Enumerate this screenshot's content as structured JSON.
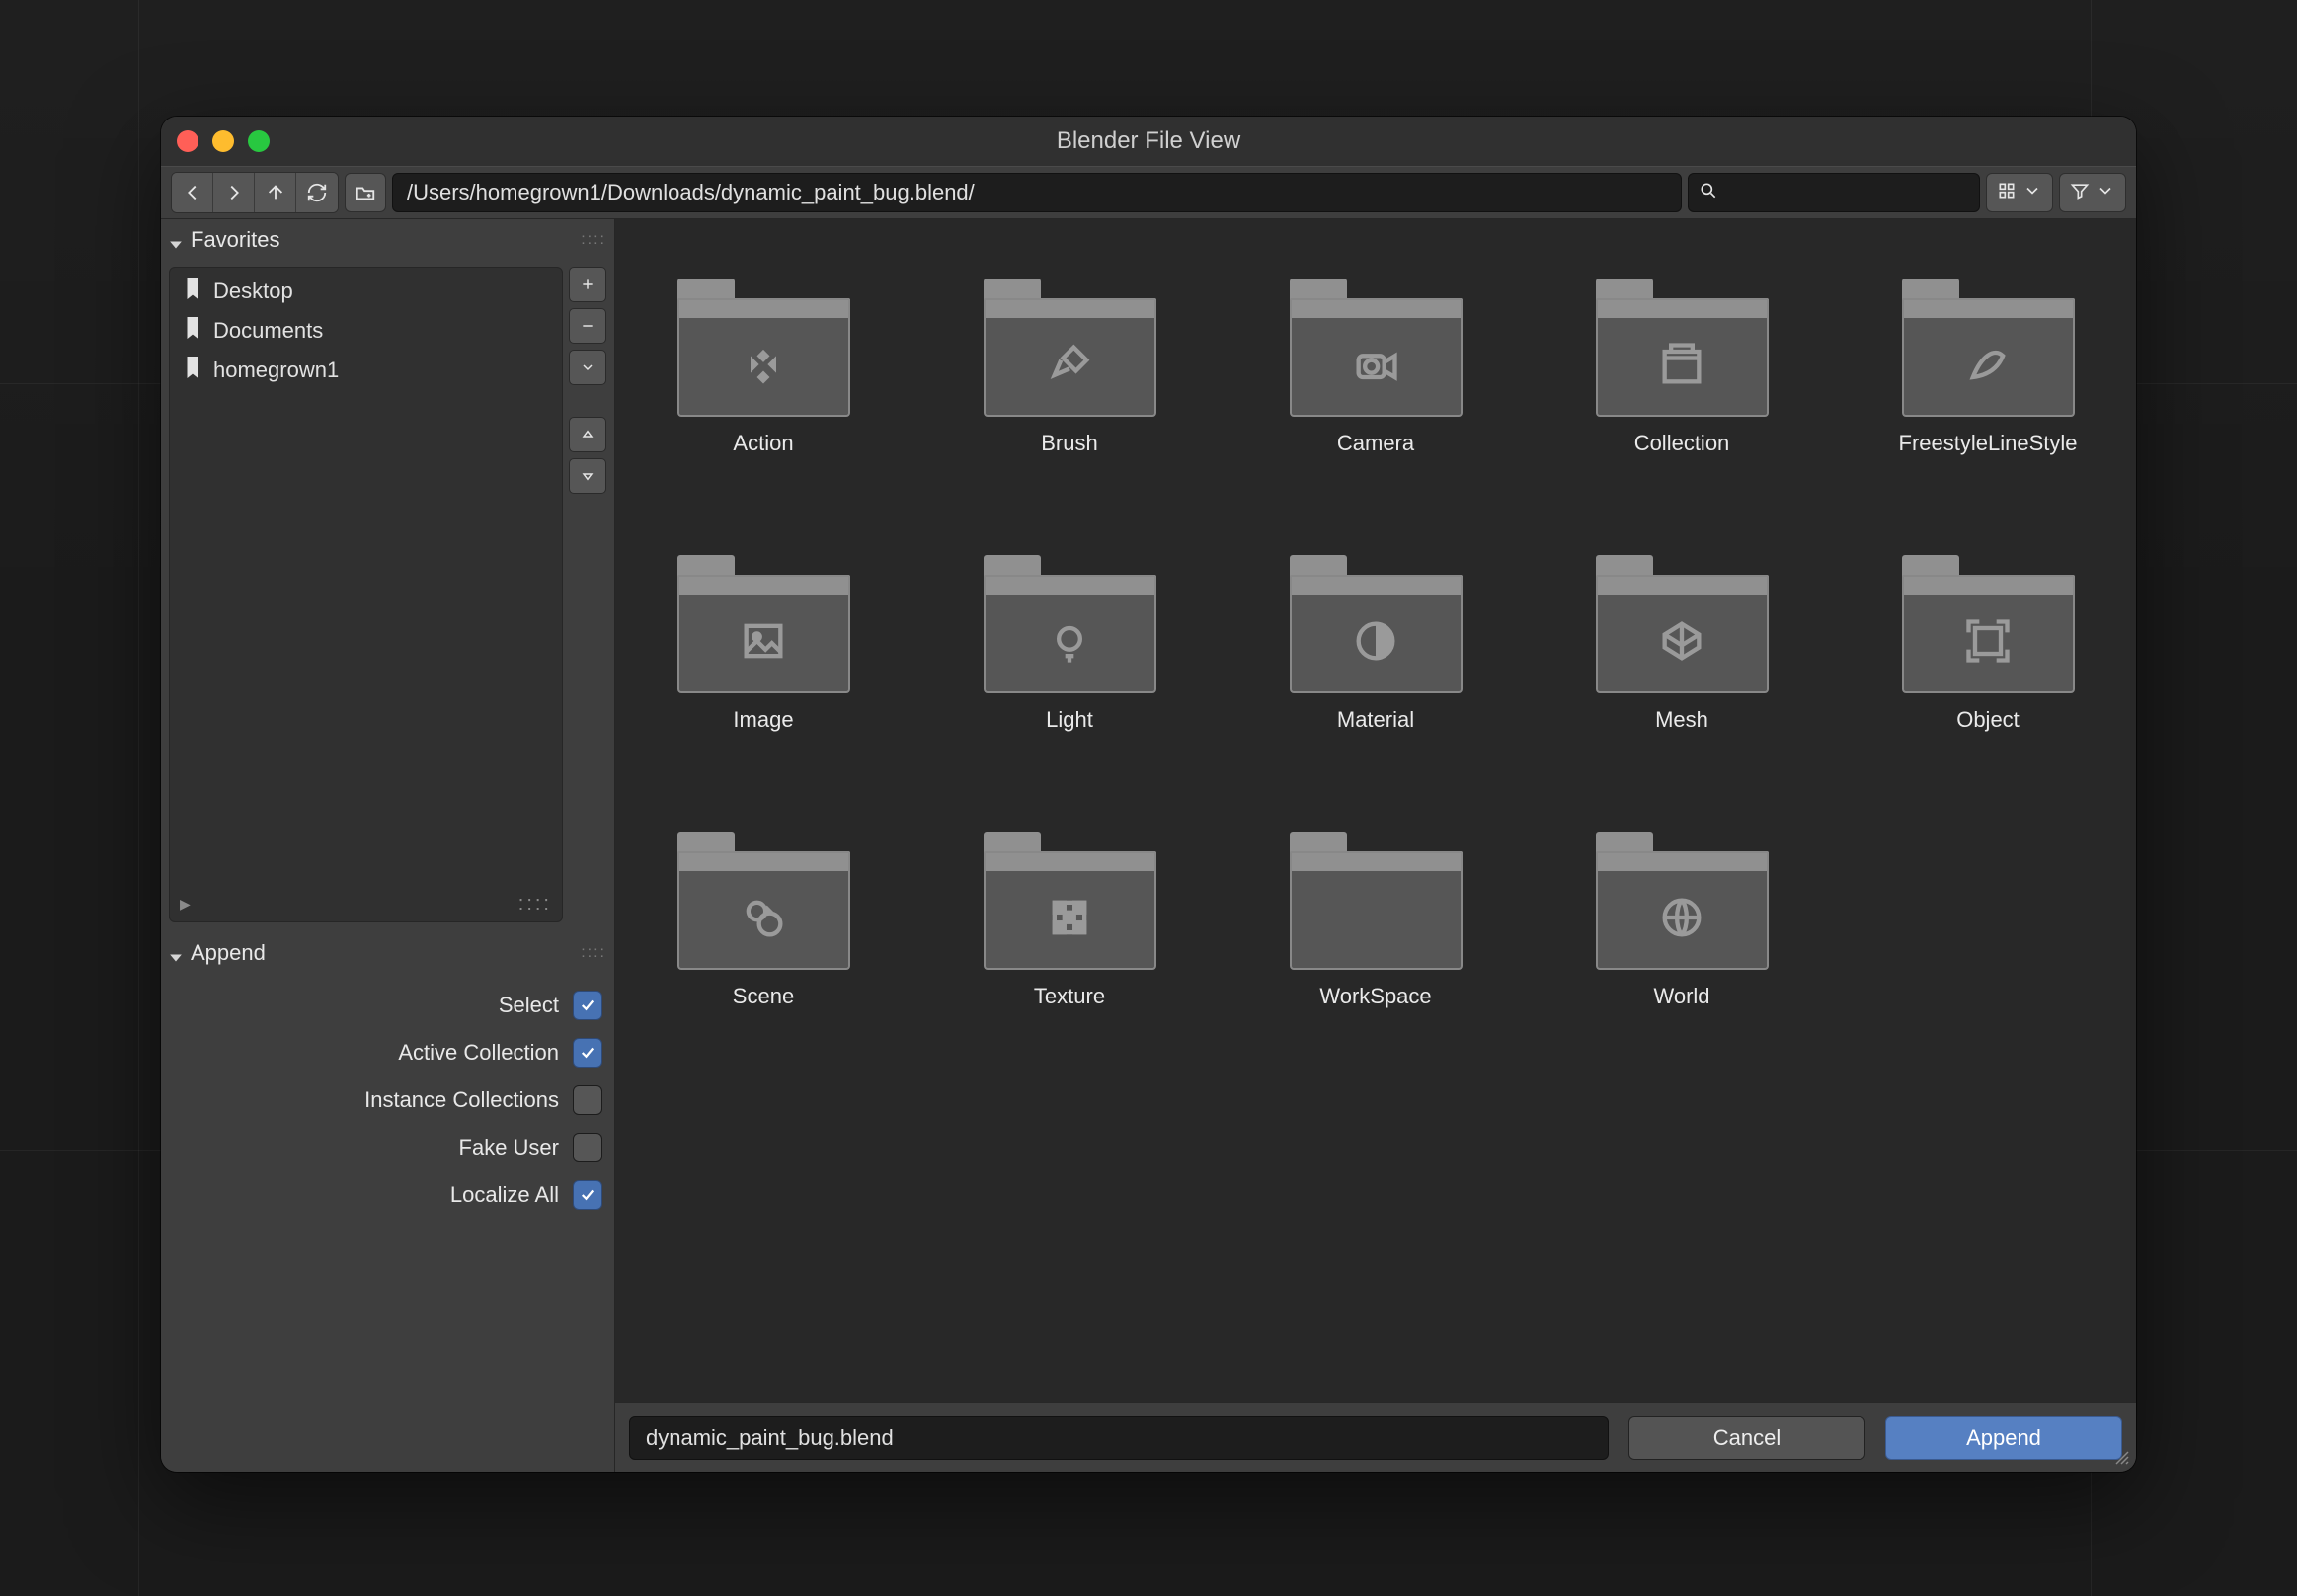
{
  "window": {
    "title": "Blender File View"
  },
  "toolbar": {
    "path": "/Users/homegrown1/Downloads/dynamic_paint_bug.blend/",
    "search_placeholder": ""
  },
  "sidebar": {
    "favorites": {
      "title": "Favorites",
      "items": [
        {
          "label": "Desktop"
        },
        {
          "label": "Documents"
        },
        {
          "label": "homegrown1"
        }
      ]
    },
    "append": {
      "title": "Append",
      "options": [
        {
          "label": "Select",
          "checked": true
        },
        {
          "label": "Active Collection",
          "checked": true
        },
        {
          "label": "Instance Collections",
          "checked": false
        },
        {
          "label": "Fake User",
          "checked": false
        },
        {
          "label": "Localize All",
          "checked": true
        }
      ]
    }
  },
  "content": {
    "items": [
      {
        "label": "Action",
        "icon": "keyframes"
      },
      {
        "label": "Brush",
        "icon": "brush"
      },
      {
        "label": "Camera",
        "icon": "camera"
      },
      {
        "label": "Collection",
        "icon": "collection"
      },
      {
        "label": "FreestyleLineStyle",
        "icon": "stroke"
      },
      {
        "label": "Image",
        "icon": "image"
      },
      {
        "label": "Light",
        "icon": "light"
      },
      {
        "label": "Material",
        "icon": "material"
      },
      {
        "label": "Mesh",
        "icon": "mesh"
      },
      {
        "label": "Object",
        "icon": "object"
      },
      {
        "label": "Scene",
        "icon": "scene"
      },
      {
        "label": "Texture",
        "icon": "texture"
      },
      {
        "label": "WorkSpace",
        "icon": "workspace"
      },
      {
        "label": "World",
        "icon": "world"
      }
    ]
  },
  "footer": {
    "filename": "dynamic_paint_bug.blend",
    "cancel_label": "Cancel",
    "confirm_label": "Append"
  }
}
